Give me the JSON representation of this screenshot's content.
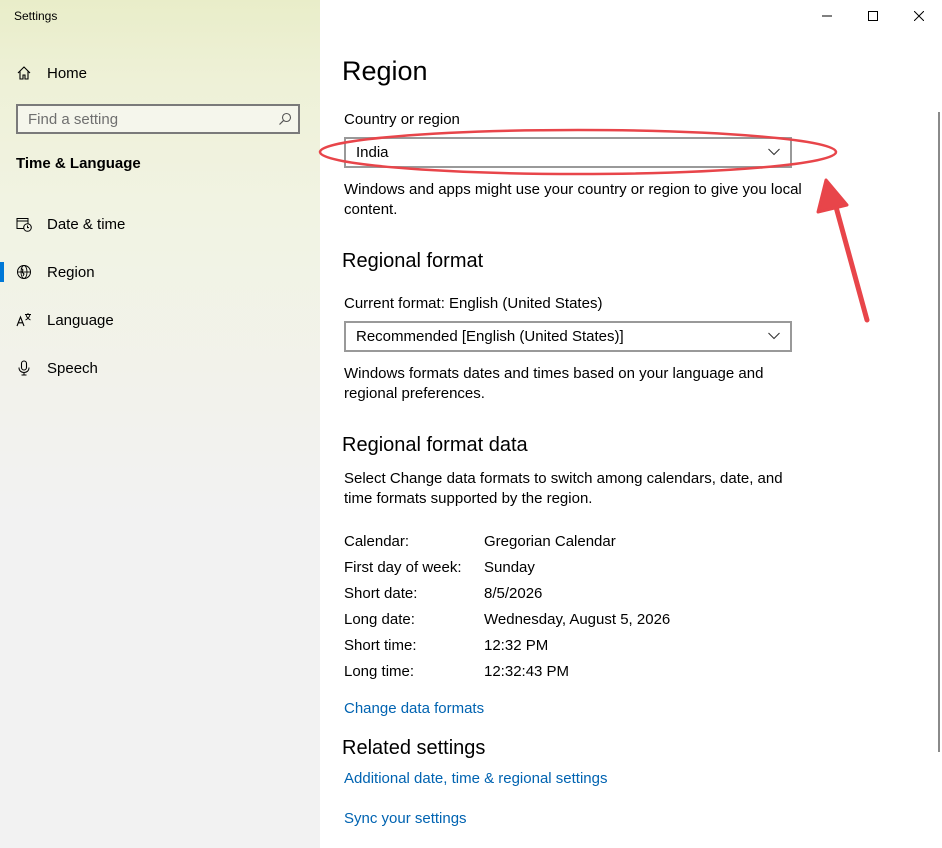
{
  "window": {
    "title": "Settings",
    "controls": [
      "minimize-icon",
      "maximize-icon",
      "close-icon"
    ]
  },
  "sidebar": {
    "home_label": "Home",
    "search_placeholder": "Find a setting",
    "section_title": "Time & Language",
    "items": [
      {
        "label": "Date & time",
        "icon": "calendar-clock-icon",
        "active": false
      },
      {
        "label": "Region",
        "icon": "globe-icon",
        "active": true
      },
      {
        "label": "Language",
        "icon": "language-icon",
        "active": false
      },
      {
        "label": "Speech",
        "icon": "microphone-icon",
        "active": false
      }
    ]
  },
  "main": {
    "page_title": "Region",
    "country": {
      "label": "Country or region",
      "selected": "India",
      "description": "Windows and apps might use your country or region to give you local content."
    },
    "regional_format": {
      "heading": "Regional format",
      "current_label": "Current format: English (United States)",
      "selected": "Recommended [English (United States)]",
      "description": "Windows formats dates and times based on your language and regional preferences."
    },
    "format_data": {
      "heading": "Regional format data",
      "description": "Select Change data formats to switch among calendars, date, and time formats supported by the region.",
      "rows": [
        {
          "key": "Calendar:",
          "value": "Gregorian Calendar"
        },
        {
          "key": "First day of week:",
          "value": "Sunday"
        },
        {
          "key": "Short date:",
          "value": "8/5/2026"
        },
        {
          "key": "Long date:",
          "value": "Wednesday, August 5, 2026"
        },
        {
          "key": "Short time:",
          "value": "12:32 PM"
        },
        {
          "key": "Long time:",
          "value": "12:32:43 PM"
        }
      ],
      "change_link": "Change data formats"
    },
    "related": {
      "heading": "Related settings",
      "link1": "Additional date, time & regional settings",
      "link2": "Sync your settings"
    }
  },
  "colors": {
    "accent": "#0078d7",
    "link": "#0063b1",
    "annotation": "#e8454a"
  }
}
